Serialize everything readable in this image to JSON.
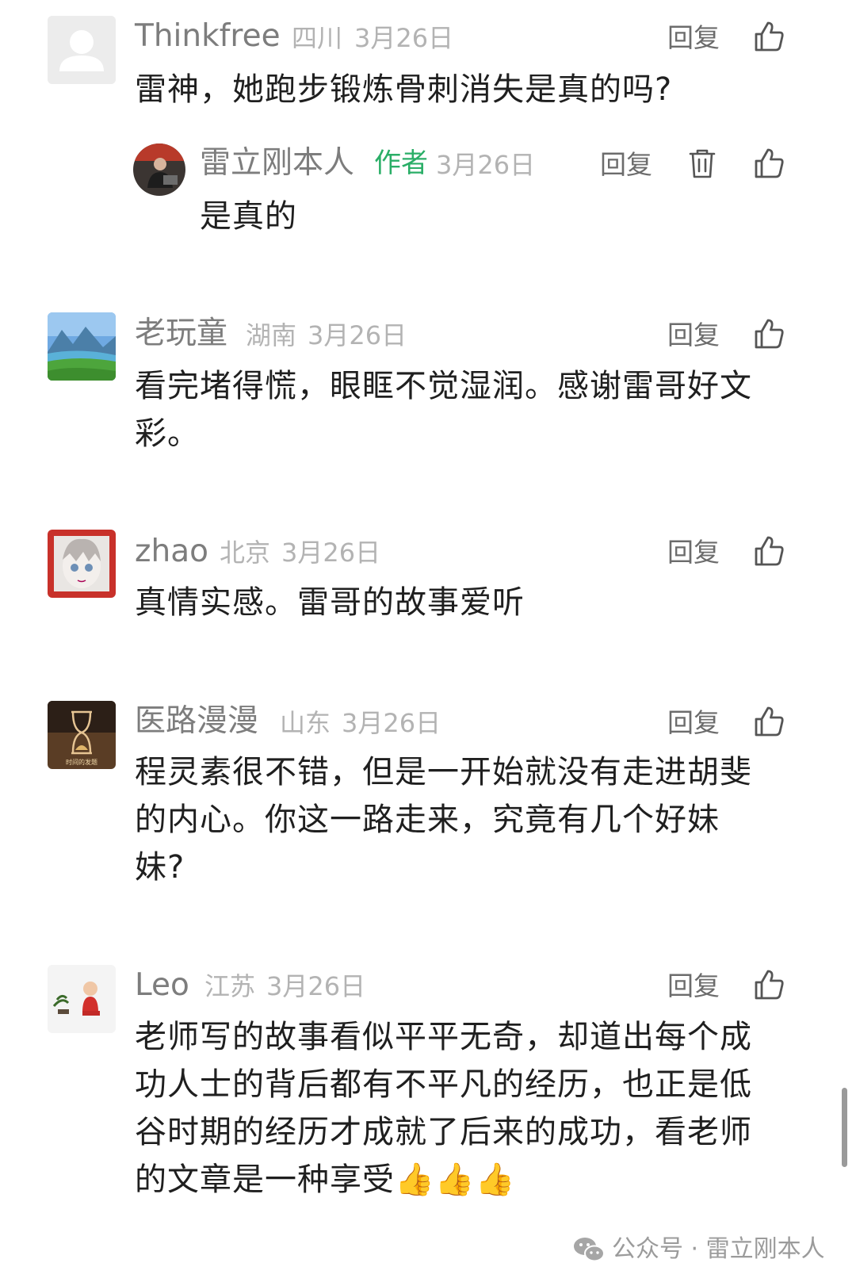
{
  "comments": [
    {
      "name": "Thinkfree",
      "location": "四川",
      "date": "3月26日",
      "reply_label": "回复",
      "text": "雷神，她跑步锻炼骨刺消失是真的吗?",
      "avatar": "default-avatar",
      "reply": {
        "name": "雷立刚本人",
        "tag": "作者",
        "date": "3月26日",
        "reply_label": "回复",
        "text": "是真的",
        "avatar": "author-avatar"
      }
    },
    {
      "name": "老玩童",
      "location": "湖南",
      "date": "3月26日",
      "reply_label": "回复",
      "text": "看完堵得慌，眼眶不觉湿润。感谢雷哥好文彩。",
      "avatar": "landscape-avatar"
    },
    {
      "name": "zhao",
      "location": "北京",
      "date": "3月26日",
      "reply_label": "回复",
      "text": "真情实感。雷哥的故事爱听",
      "avatar": "anime-avatar"
    },
    {
      "name": "医路漫漫",
      "location": "山东",
      "date": "3月26日",
      "reply_label": "回复",
      "text": "程灵素很不错，但是一开始就没有走进胡斐的内心。你这一路走来，究竟有几个好妹妹?",
      "avatar": "hourglass-avatar",
      "avatar_caption": "时间的发题"
    },
    {
      "name": "Leo",
      "location": "江苏",
      "date": "3月26日",
      "reply_label": "回复",
      "text": "老师写的故事看似平平无奇，却道出每个成功人士的背后都有不平凡的经历，也正是低谷时期的经历才成就了后来的成功，看老师的文章是一种享受👍👍👍",
      "avatar": "baby-avatar"
    }
  ],
  "watermark": "公众号 · 雷立刚本人",
  "colors": {
    "author_tag": "#2aae67",
    "meta": "#b3b3b3",
    "name": "#7d7d7d",
    "text": "#1f1f1f"
  }
}
